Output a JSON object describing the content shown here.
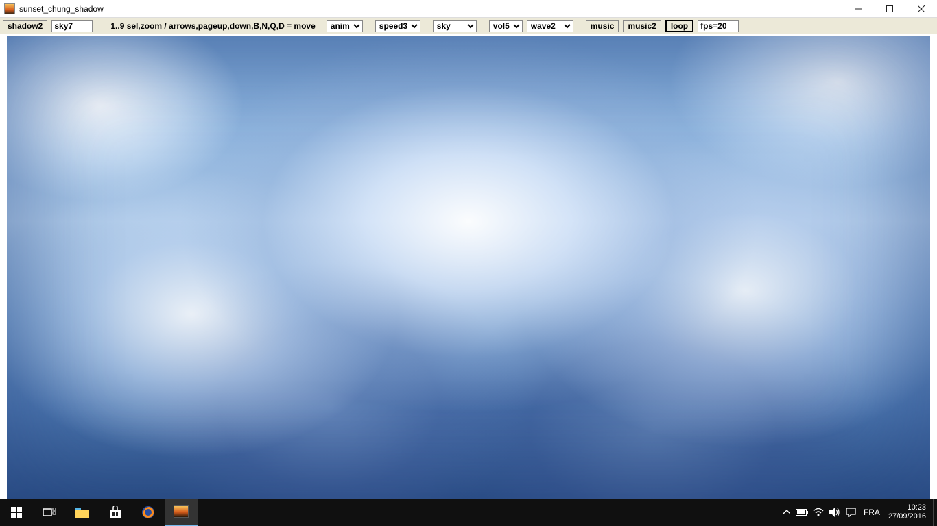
{
  "window": {
    "title": "sunset_chung_shadow"
  },
  "toolbar": {
    "shadow_btn": "shadow2",
    "sky_label": "sky7",
    "help_text": "1..9 sel,zoom / arrows,pageup,down,B,N,Q,D = move",
    "anim_select": "anim",
    "speed_select": "speed3",
    "sky_select": "sky",
    "vol_select": "vol5",
    "wave_select": "wave2",
    "music_btn": "music",
    "music2_btn": "music2",
    "loop_btn": "loop",
    "fps_text": "fps=20"
  },
  "taskbar": {
    "lang": "FRA",
    "time": "10:23",
    "date": "27/09/2016"
  }
}
